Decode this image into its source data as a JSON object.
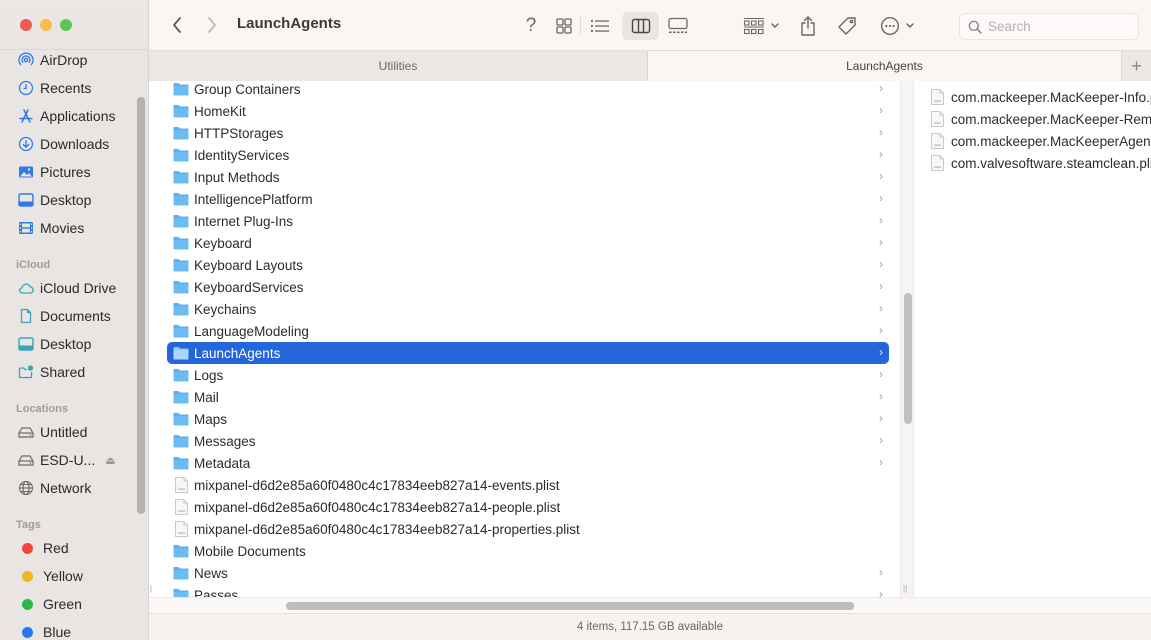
{
  "window": {
    "title": "LaunchAgents",
    "traffic_lights": [
      "close",
      "minimize",
      "zoom"
    ]
  },
  "toolbar": {
    "back_icon": "chevron-left-icon",
    "forward_icon": "chevron-right-icon",
    "help_label": "?",
    "view_icons": [
      "icon-view-icon",
      "list-view-icon",
      "column-view-icon",
      "gallery-view-icon"
    ],
    "active_view": "column-view",
    "group_icon": "group-by-icon",
    "share_icon": "share-icon",
    "tag_icon": "tag-icon",
    "more_icon": "ellipsis-circle-icon",
    "search_placeholder": "Search",
    "search_value": ""
  },
  "tabs": [
    {
      "label": "Utilities",
      "active": false
    },
    {
      "label": "LaunchAgents",
      "active": true
    }
  ],
  "tab_add_label": "+",
  "sidebar": {
    "favorites": [
      {
        "label": "AirDrop",
        "icon": "airdrop-icon"
      },
      {
        "label": "Recents",
        "icon": "clock-icon"
      },
      {
        "label": "Applications",
        "icon": "applications-icon"
      },
      {
        "label": "Downloads",
        "icon": "download-icon"
      },
      {
        "label": "Pictures",
        "icon": "photo-icon"
      },
      {
        "label": "Desktop",
        "icon": "desktop-icon"
      },
      {
        "label": "Movies",
        "icon": "film-icon"
      }
    ],
    "icloud_heading": "iCloud",
    "icloud": [
      {
        "label": "iCloud Drive",
        "icon": "cloud-icon"
      },
      {
        "label": "Documents",
        "icon": "document-icon"
      },
      {
        "label": "Desktop",
        "icon": "desktop-icon"
      },
      {
        "label": "Shared",
        "icon": "shared-folder-icon"
      }
    ],
    "locations_heading": "Locations",
    "locations": [
      {
        "label": "Untitled",
        "icon": "drive-icon"
      },
      {
        "label": "ESD-U...",
        "icon": "drive-icon",
        "eject": true
      },
      {
        "label": "Network",
        "icon": "globe-icon"
      }
    ],
    "tags_heading": "Tags",
    "tags": [
      {
        "label": "Red",
        "color": "#f0453f"
      },
      {
        "label": "Yellow",
        "color": "#f2b51f"
      },
      {
        "label": "Green",
        "color": "#2fb44a"
      },
      {
        "label": "Blue",
        "color": "#2a76f0"
      }
    ]
  },
  "column1": {
    "items": [
      {
        "name": "Group Containers",
        "type": "folder"
      },
      {
        "name": "HomeKit",
        "type": "folder"
      },
      {
        "name": "HTTPStorages",
        "type": "folder"
      },
      {
        "name": "IdentityServices",
        "type": "folder"
      },
      {
        "name": "Input Methods",
        "type": "folder"
      },
      {
        "name": "IntelligencePlatform",
        "type": "folder"
      },
      {
        "name": "Internet Plug-Ins",
        "type": "folder"
      },
      {
        "name": "Keyboard",
        "type": "folder"
      },
      {
        "name": "Keyboard Layouts",
        "type": "folder"
      },
      {
        "name": "KeyboardServices",
        "type": "folder"
      },
      {
        "name": "Keychains",
        "type": "folder"
      },
      {
        "name": "LanguageModeling",
        "type": "folder"
      },
      {
        "name": "LaunchAgents",
        "type": "folder",
        "selected": true
      },
      {
        "name": "Logs",
        "type": "folder"
      },
      {
        "name": "Mail",
        "type": "folder"
      },
      {
        "name": "Maps",
        "type": "folder"
      },
      {
        "name": "Messages",
        "type": "folder"
      },
      {
        "name": "Metadata",
        "type": "folder"
      },
      {
        "name": "mixpanel-d6d2e85a60f0480c4c17834eeb827a14-events.plist",
        "type": "file"
      },
      {
        "name": "mixpanel-d6d2e85a60f0480c4c17834eeb827a14-people.plist",
        "type": "file"
      },
      {
        "name": "mixpanel-d6d2e85a60f0480c4c17834eeb827a14-properties.plist",
        "type": "file"
      },
      {
        "name": "Mobile Documents",
        "type": "folder",
        "no_chevron": true
      },
      {
        "name": "News",
        "type": "folder"
      },
      {
        "name": "Passes",
        "type": "folder"
      }
    ]
  },
  "column2": {
    "items": [
      {
        "name": "com.mackeeper.MacKeeper-Info.plist",
        "type": "file"
      },
      {
        "name": "com.mackeeper.MacKeeper-Remove.plist",
        "type": "file"
      },
      {
        "name": "com.mackeeper.MacKeeperAgent.plist",
        "type": "file"
      },
      {
        "name": "com.valvesoftware.steamclean.plist",
        "type": "file"
      }
    ]
  },
  "status_bar": "4 items, 117.15 GB available",
  "colors": {
    "selection": "#2465da",
    "folder": "#5aaff0",
    "sidebar_icon": "#2f7ae5",
    "icloud_icon": "#3aa3b8"
  }
}
